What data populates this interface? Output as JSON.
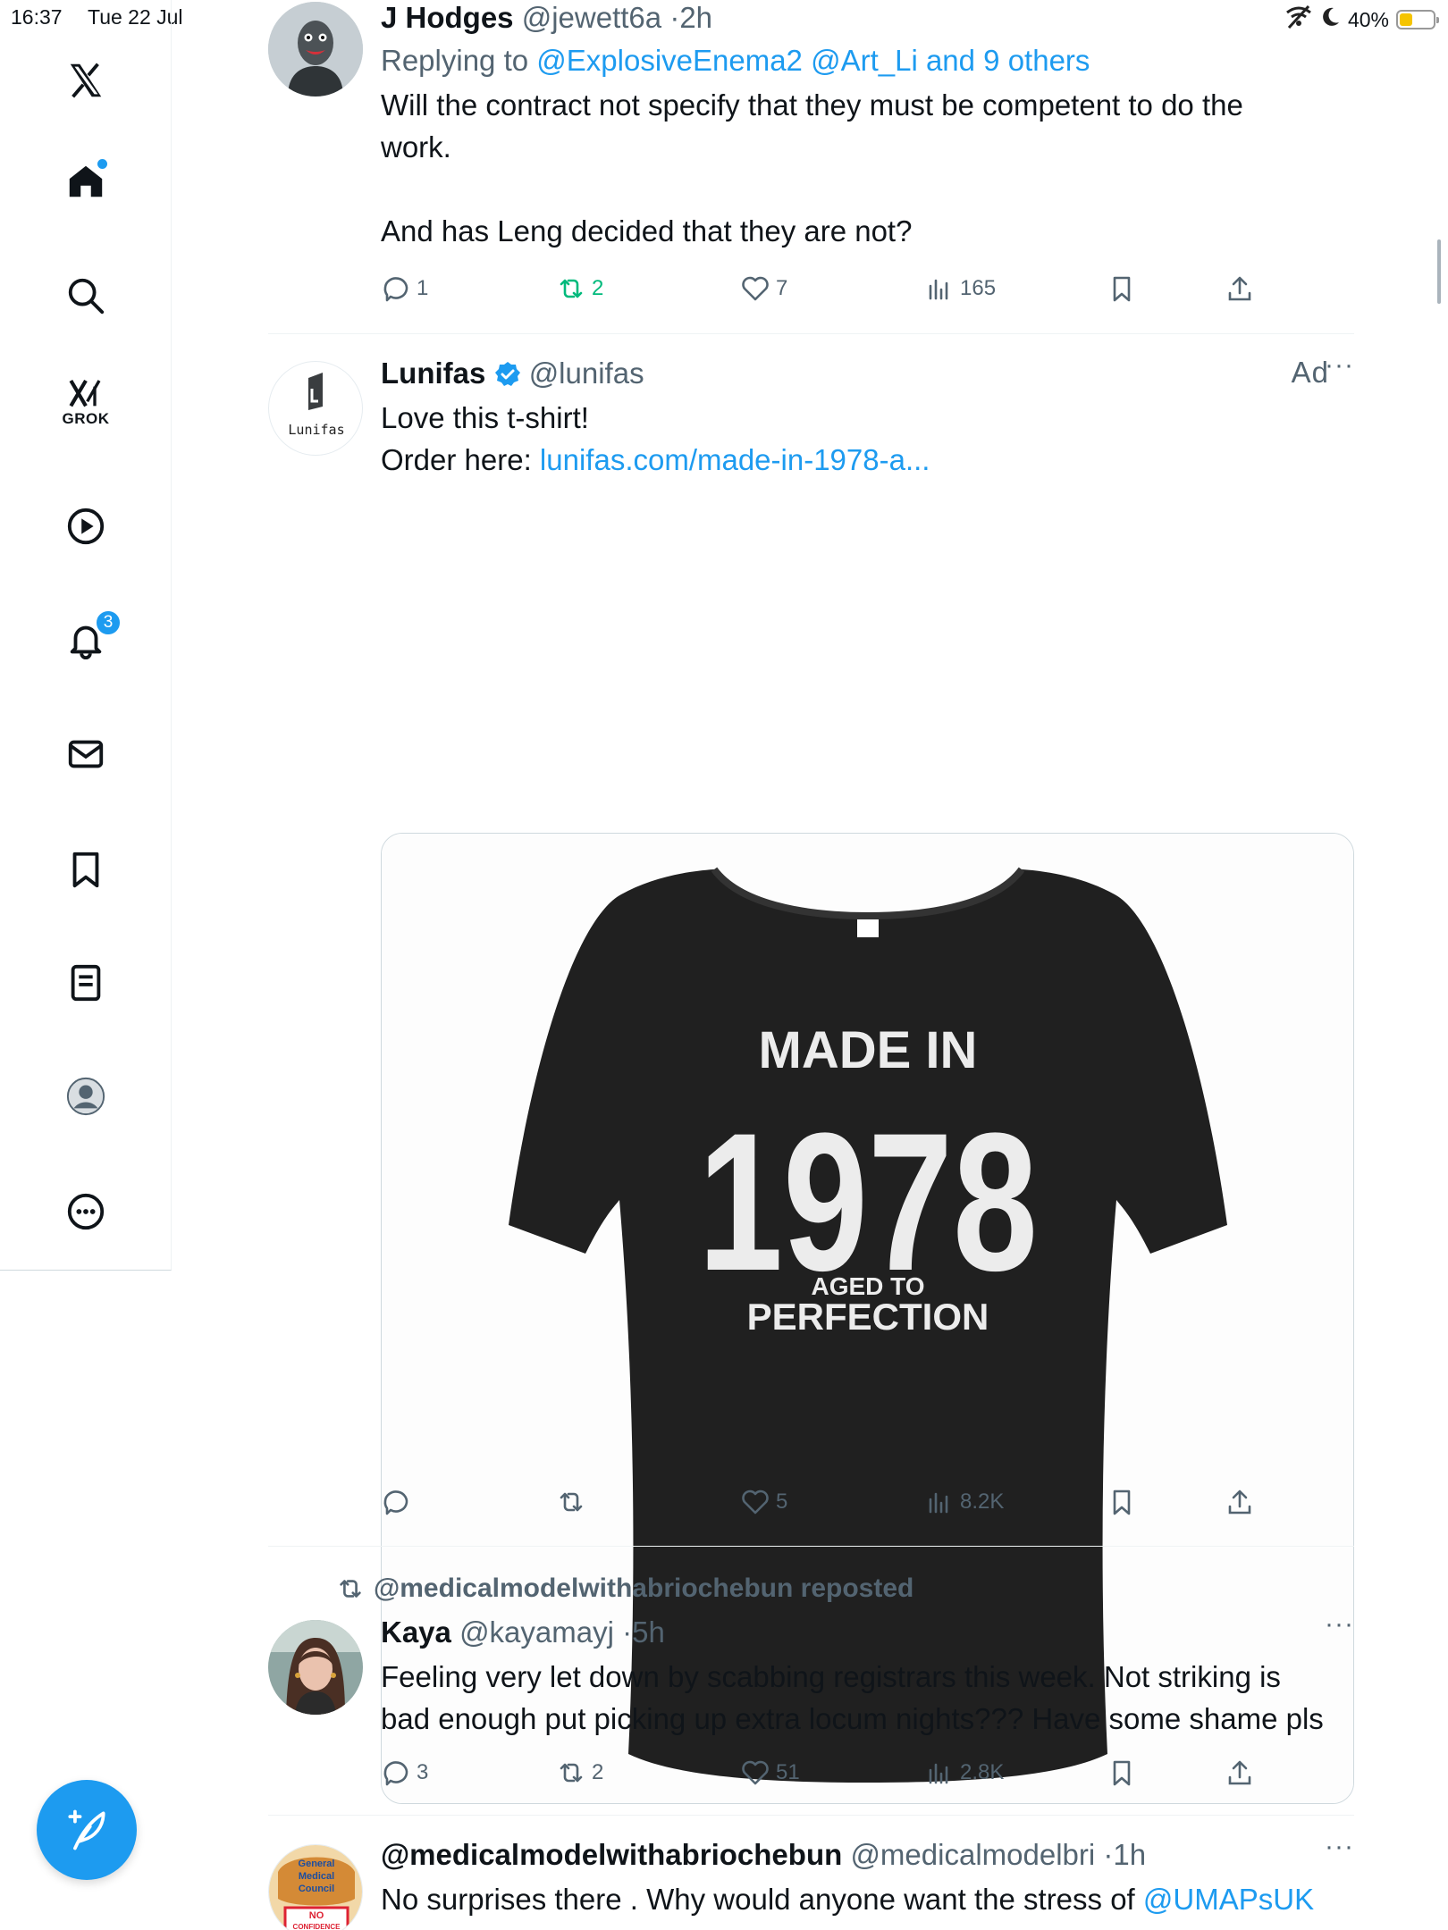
{
  "status_bar": {
    "time": "16:37",
    "date": "Tue 22 Jul",
    "battery": "40%",
    "battery_level": 0.4
  },
  "sidebar": {
    "grok_label": "GROK",
    "notifications_count": "3",
    "icons": [
      "x-logo-icon",
      "home-icon",
      "search-icon",
      "grok-icon",
      "video-icon",
      "bell-icon",
      "mail-icon",
      "bookmark-icon",
      "lists-icon",
      "profile-icon",
      "more-icon"
    ]
  },
  "posts": [
    {
      "name": "J Hodges",
      "handle": "@jewett6a",
      "sep": "·",
      "time": "2h",
      "replying_prefix": "Replying to ",
      "replying_to": "@ExplosiveEnema2 @Art_Li and 9 others",
      "text_1": "Will the contract not specify that they must be competent to do the",
      "text_2": "work.",
      "text_3": "And has Leng decided that they are not?",
      "replies": "1",
      "reposts": "2",
      "likes": "7",
      "views": "165"
    },
    {
      "name": "Lunifas",
      "handle": "@lunifas",
      "ad_label": "Ad",
      "avatar_text": "Lunifas",
      "text_1": "Love this t-shirt!",
      "text_2": "Order here: ",
      "link": "lunifas.com/made-in-1978-a...",
      "shirt_line_1": "MADE IN",
      "shirt_year": "1978",
      "shirt_line_2": "AGED TO",
      "shirt_line_3": "PERFECTION",
      "likes": "5",
      "views": "8.2K"
    },
    {
      "reposted_by": "@medicalmodelwithabriochebun reposted",
      "name": "Kaya",
      "handle": "@kayamayj",
      "sep": "·",
      "time": "5h",
      "text_1": "Feeling very let down by scabbing registrars this week. Not striking is",
      "text_2": "bad enough put picking up extra locum nights??? Have some shame pls",
      "replies": "3",
      "reposts": "2",
      "likes": "51",
      "views": "2.8K"
    },
    {
      "name": "@medicalmodelwithabriochebun",
      "handle": "@medicalmodelbri",
      "sep": "·",
      "time": "1h",
      "text_1": "No surprises there . Why would anyone want the stress of ",
      "mention": "@UMAPsUK",
      "avatar_lines": [
        "General",
        "Medical",
        "Council",
        "NO",
        "CONFIDENCE"
      ]
    }
  ]
}
